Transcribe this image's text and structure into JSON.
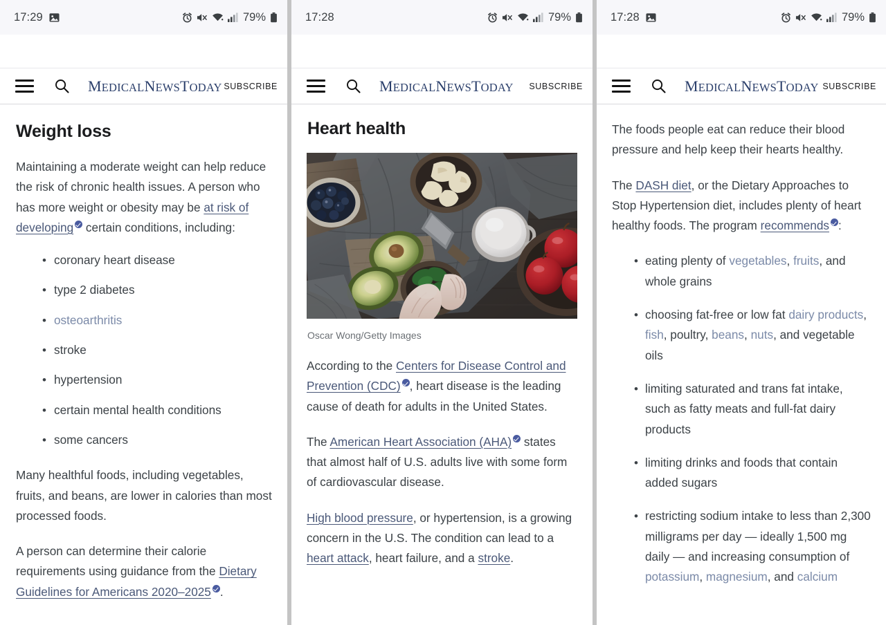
{
  "panels": [
    {
      "status": {
        "time": "17:29",
        "has_image_icon": true,
        "battery_pct": "79%",
        "icons": [
          "image-icon",
          "alarm-icon",
          "mute-icon",
          "wifi-icon",
          "signal-icon",
          "battery-icon"
        ]
      },
      "header": {
        "menu": "menu-icon",
        "search": "search-icon",
        "brand_parts": [
          "M",
          "EDICAL",
          "N",
          "EWS",
          "T",
          "ODAY"
        ],
        "subscribe": "SUBSCRIBE"
      },
      "title": "Weight loss",
      "paragraph1": {
        "pre": "Maintaining a moderate weight can help reduce the risk of chronic health issues. A person who has more weight or obesity may be ",
        "link": "at risk of developing",
        "post": " certain conditions, including:"
      },
      "bullets": [
        {
          "text": "coronary heart disease",
          "link": false
        },
        {
          "text": "type 2 diabetes",
          "link": false
        },
        {
          "text": "osteoarthritis",
          "link": true
        },
        {
          "text": "stroke",
          "link": false
        },
        {
          "text": "hypertension",
          "link": false
        },
        {
          "text": "certain mental health conditions",
          "link": false
        },
        {
          "text": "some cancers",
          "link": false
        }
      ],
      "paragraph2": "Many healthful foods, including vegetables, fruits, and beans, are lower in calories than most processed foods.",
      "paragraph3": {
        "pre": "A person can determine their calorie requirements using guidance from the ",
        "link": "Dietary Guidelines for Americans 2020–2025",
        "post": "."
      }
    },
    {
      "status": {
        "time": "17:28",
        "has_image_icon": false,
        "battery_pct": "79%"
      },
      "header": {
        "subscribe": "SUBSCRIBE"
      },
      "title": "Heart health",
      "image_credit": "Oscar Wong/Getty Images",
      "paragraph1": {
        "pre": "According to the ",
        "link": "Centers for Disease Control and Prevention (CDC)",
        "post": ", heart disease is the leading cause of death for adults in the United States."
      },
      "paragraph2": {
        "pre": "The ",
        "link": "American Heart Association (AHA)",
        "post": " states that almost half of U.S. adults live with some form of cardiovascular disease."
      },
      "paragraph3": {
        "link1": "High blood pressure",
        "mid1": ", or hypertension, is a growing concern in the U.S. The condition can lead to a ",
        "link2": "heart attack",
        "mid2": ", heart failure, and a ",
        "link3": "stroke",
        "end": "."
      }
    },
    {
      "status": {
        "time": "17:28",
        "has_image_icon": true,
        "battery_pct": "79%"
      },
      "header": {
        "subscribe": "SUBSCRIBE"
      },
      "paragraph1": "The foods people eat can reduce their blood pressure and help keep their hearts healthy.",
      "paragraph2": {
        "pre": "The ",
        "link1": "DASH diet",
        "mid": ", or the Dietary Approaches to Stop Hypertension diet, includes plenty of heart healthy foods. The program ",
        "link2": "recommends",
        "post": ":"
      },
      "bullets": [
        {
          "segments": [
            {
              "t": "eating plenty of ",
              "link": false
            },
            {
              "t": "vegetables",
              "link": true
            },
            {
              "t": ", ",
              "link": false
            },
            {
              "t": "fruits",
              "link": true
            },
            {
              "t": ", and whole grains",
              "link": false
            }
          ]
        },
        {
          "segments": [
            {
              "t": "choosing fat-free or low fat ",
              "link": false
            },
            {
              "t": "dairy products",
              "link": true
            },
            {
              "t": ", ",
              "link": false
            },
            {
              "t": "fish",
              "link": true
            },
            {
              "t": ", poultry, ",
              "link": false
            },
            {
              "t": "beans",
              "link": true
            },
            {
              "t": ", ",
              "link": false
            },
            {
              "t": "nuts",
              "link": true
            },
            {
              "t": ", and vegetable oils",
              "link": false
            }
          ]
        },
        {
          "segments": [
            {
              "t": "limiting saturated and trans fat intake, such as fatty meats and full-fat dairy products",
              "link": false
            }
          ]
        },
        {
          "segments": [
            {
              "t": "limiting drinks and foods that contain added sugars",
              "link": false
            }
          ]
        },
        {
          "segments": [
            {
              "t": "restricting sodium intake to less than 2,300 milligrams per day — ideally 1,500 mg daily — and increasing consumption of ",
              "link": false
            },
            {
              "t": "potassium",
              "link": true
            },
            {
              "t": ", ",
              "link": false
            },
            {
              "t": "magnesium",
              "link": true
            },
            {
              "t": ", and ",
              "link": false
            },
            {
              "t": "calcium",
              "link": true
            }
          ]
        }
      ]
    }
  ],
  "colors": {
    "brand": "#2b3f6b",
    "link": "#4a5878",
    "link_plain": "#7b8aa8",
    "verified_badge": "#4a5ba0",
    "text": "#3c4247",
    "statusbar_bg": "#f7f7fa",
    "divider": "#c4c4c4"
  }
}
